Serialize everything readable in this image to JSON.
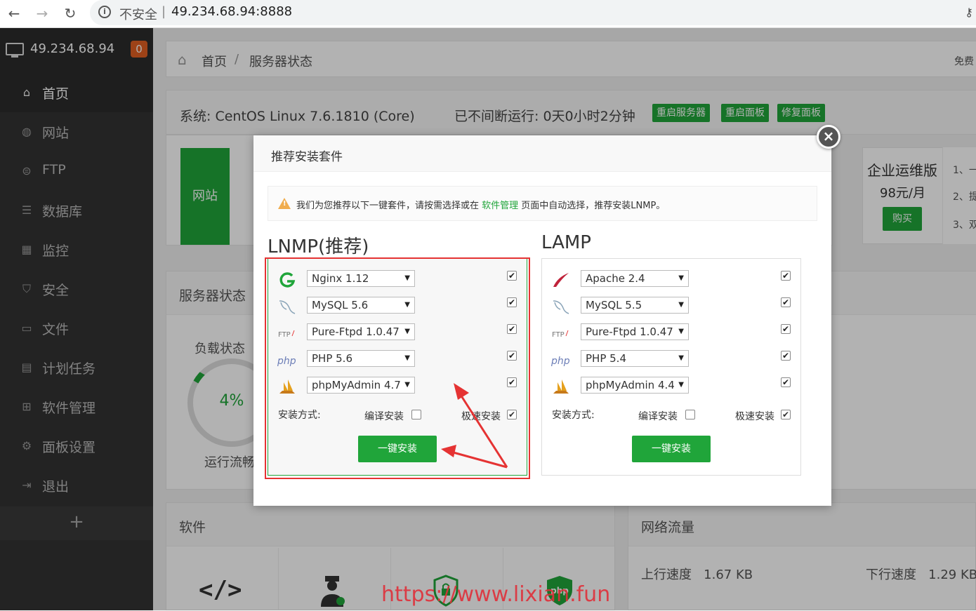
{
  "browser": {
    "security_label": "不安全",
    "separator": "|",
    "url": "49.234.68.94:8888"
  },
  "sidebar": {
    "server_ip": "49.234.68.94",
    "badge_count": "0",
    "items": [
      {
        "label": "首页",
        "icon": "home-icon"
      },
      {
        "label": "网站",
        "icon": "globe-icon"
      },
      {
        "label": "FTP",
        "icon": "ftp-icon"
      },
      {
        "label": "数据库",
        "icon": "database-icon"
      },
      {
        "label": "监控",
        "icon": "monitor-chart-icon"
      },
      {
        "label": "安全",
        "icon": "shield-icon"
      },
      {
        "label": "文件",
        "icon": "folder-icon"
      },
      {
        "label": "计划任务",
        "icon": "calendar-icon"
      },
      {
        "label": "软件管理",
        "icon": "grid-icon"
      },
      {
        "label": "面板设置",
        "icon": "gear-icon"
      },
      {
        "label": "退出",
        "icon": "logout-icon"
      }
    ],
    "add_label": "+"
  },
  "breadcrumb": {
    "home": "首页",
    "sep": "/",
    "current": "服务器状态",
    "right_text": "免费"
  },
  "system": {
    "os": "系统: CentOS Linux 7.6.1810 (Core)",
    "uptime": "已不间断运行: 0天0小时2分钟",
    "btn_restart_server": "重启服务器",
    "btn_restart_panel": "重启面板",
    "btn_repair_panel": "修复面板"
  },
  "stats": {
    "site_tile": "网站"
  },
  "enterprise": {
    "title": "企业运维版",
    "price": "98元/月",
    "buy": "购买",
    "list": [
      "1、一",
      "2、提",
      "3、双"
    ]
  },
  "server_status": {
    "title": "服务器状态",
    "load_label": "负载状态",
    "load_pct": "4%",
    "load_value": 0.04,
    "flow_label": "运行流畅"
  },
  "software": {
    "title": "软件"
  },
  "network": {
    "title": "网络流量",
    "up_label": "上行速度",
    "up_value": "1.67 KB",
    "down_label": "下行速度",
    "down_value": "1.29 KB"
  },
  "modal": {
    "title": "推荐安装套件",
    "close": "×",
    "tip_before": "我们为您推荐以下一键套件，请按需选择或在 ",
    "tip_link": "软件管理",
    "tip_after": " 页面中自动选择，推荐安装LNMP。",
    "lnmp": {
      "title": "LNMP(推荐)",
      "rows": [
        {
          "icon": "nginx-icon",
          "value": "Nginx 1.12",
          "checked": "✔"
        },
        {
          "icon": "mysql-icon",
          "value": "MySQL 5.6",
          "checked": "✔"
        },
        {
          "icon": "ftp-icon",
          "value": "Pure-Ftpd 1.0.47",
          "checked": "✔"
        },
        {
          "icon": "php-icon",
          "value": "PHP 5.6",
          "checked": "✔"
        },
        {
          "icon": "phpmyadmin-icon",
          "value": "phpMyAdmin 4.7",
          "checked": "✔"
        }
      ],
      "mode_label": "安装方式:",
      "compile_label": "编译安装",
      "fast_label": "极速安装",
      "fast_checked": "✔",
      "install_btn": "一键安装"
    },
    "lamp": {
      "title": "LAMP",
      "rows": [
        {
          "icon": "apache-icon",
          "value": "Apache 2.4",
          "checked": "✔"
        },
        {
          "icon": "mysql-icon",
          "value": "MySQL 5.5",
          "checked": "✔"
        },
        {
          "icon": "ftp-icon",
          "value": "Pure-Ftpd 1.0.47",
          "checked": "✔"
        },
        {
          "icon": "php-icon",
          "value": "PHP 5.4",
          "checked": "✔"
        },
        {
          "icon": "phpmyadmin-icon",
          "value": "phpMyAdmin 4.4",
          "checked": "✔"
        }
      ],
      "mode_label": "安装方式:",
      "compile_label": "编译安装",
      "fast_label": "极速安装",
      "fast_checked": "✔",
      "install_btn": "一键安装"
    }
  },
  "watermark": "https://www.lixian.fun",
  "colors": {
    "accent_green": "#20a53a",
    "badge_orange": "#e15f21",
    "highlight_red": "#e53333",
    "sidebar_bg": "#333333"
  }
}
